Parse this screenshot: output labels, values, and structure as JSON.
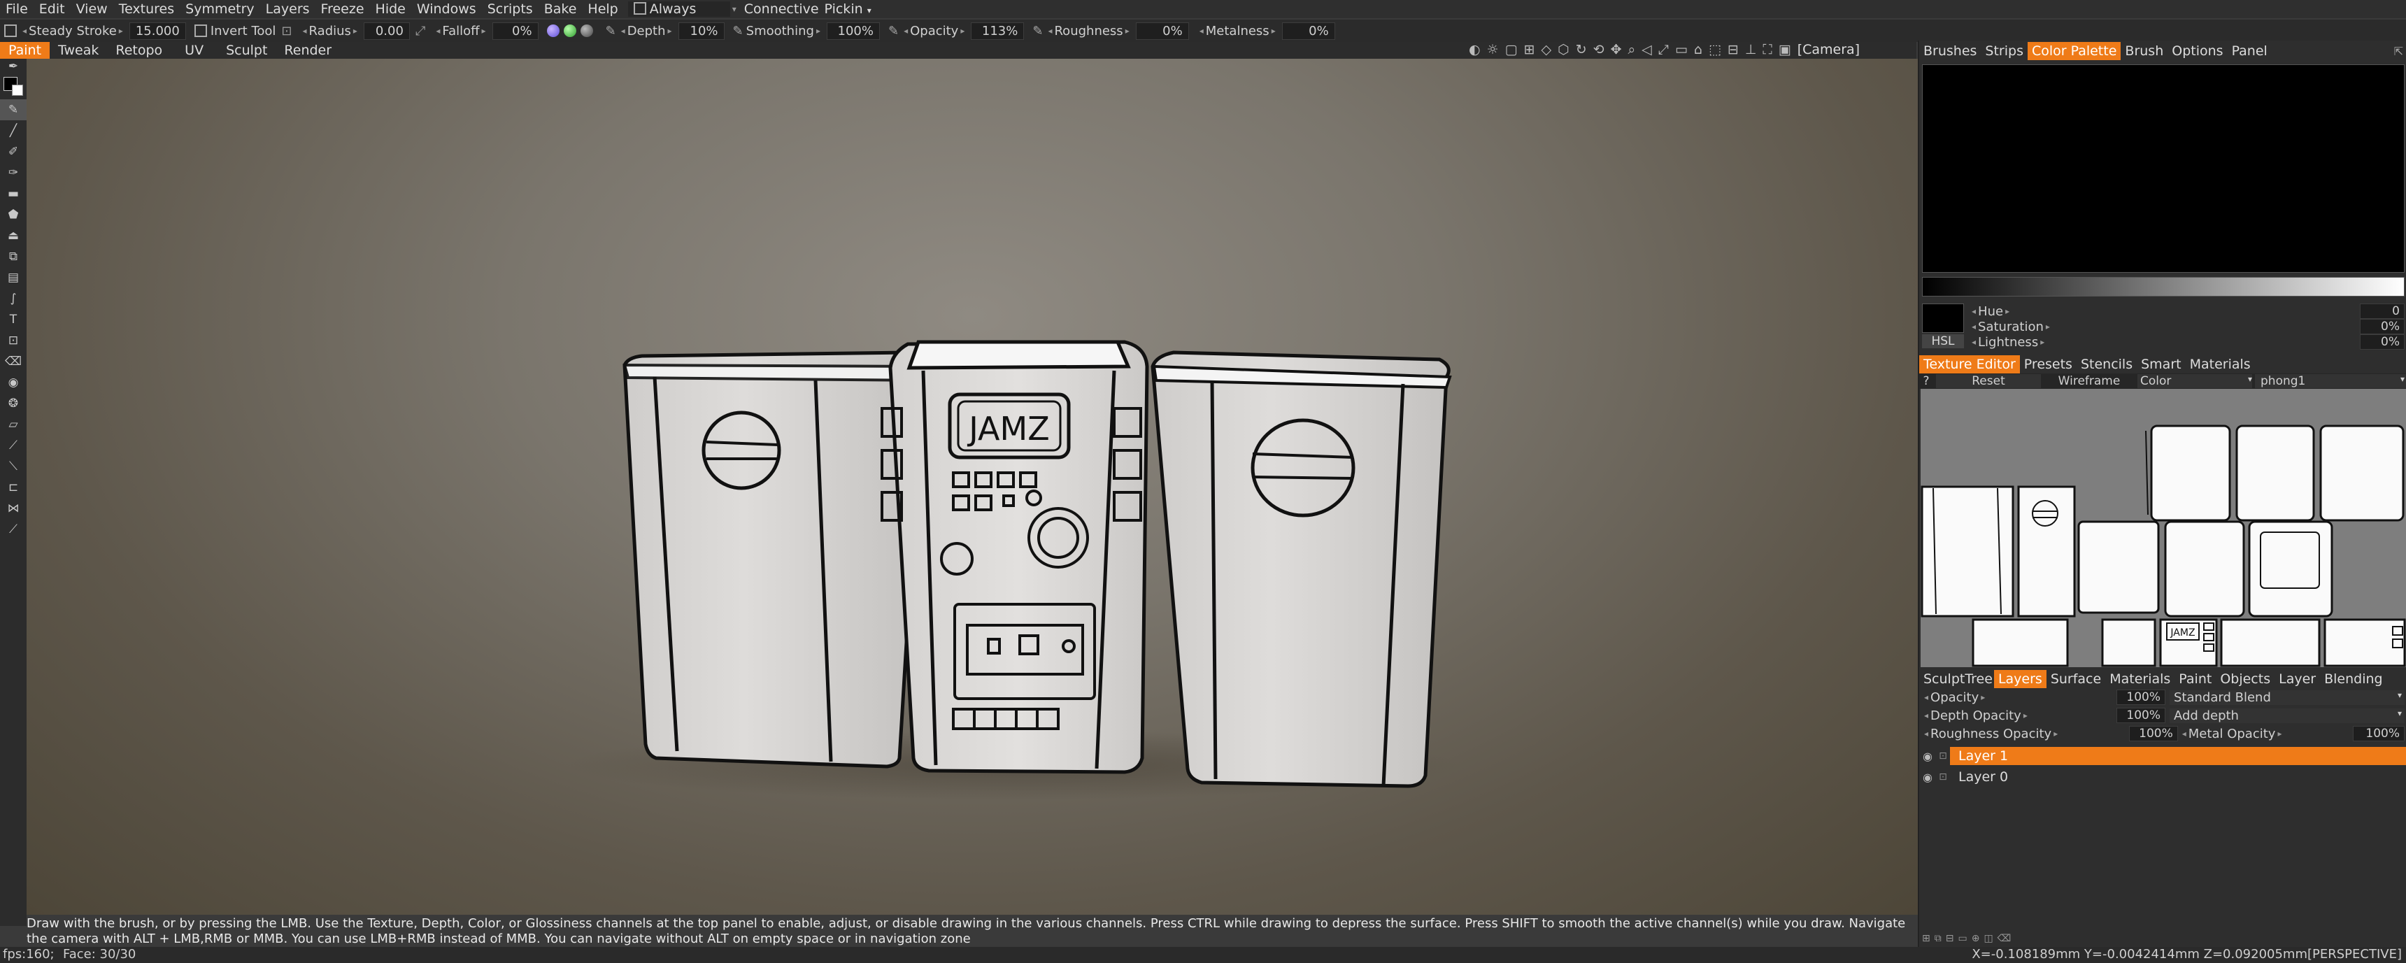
{
  "menu": {
    "items": [
      "File",
      "Edit",
      "View",
      "Textures",
      "Symmetry",
      "Layers",
      "Freeze",
      "Hide",
      "Windows",
      "Scripts",
      "Bake",
      "Help"
    ],
    "always_label": "Always",
    "connective_label": "Connective",
    "pickin_label": "Pickin"
  },
  "params": {
    "steady_stroke_label": "Steady",
    "stroke_label": "Stroke",
    "stroke_value": "15.000",
    "invert_tool_label": "Invert",
    "tool_label": "Tool",
    "radius_label": "Radius",
    "radius_value": "0.00",
    "falloff_label": "Falloff",
    "falloff_value": "0%",
    "depth_label": "Depth",
    "depth_value": "10%",
    "smoothing_label": "Smoothing",
    "smoothing_value": "100%",
    "opacity_label": "Opacity",
    "opacity_value": "113%",
    "roughness_label": "Roughness",
    "roughness_value": "0%",
    "metalness_label": "Metalness",
    "metalness_value": "0%"
  },
  "rooms": [
    "Paint",
    "Tweak",
    "Retopo",
    "UV",
    "Sculpt",
    "Render"
  ],
  "camera_label": "[Camera]",
  "model": {
    "label_text": "JAMZ"
  },
  "hint": {
    "line1": "Draw with the brush, or by pressing the LMB. Use the Texture, Depth, Color, or Glossiness channels at the top panel to enable, adjust, or disable drawing in the various channels. Press CTRL while drawing to depress the surface. Press SHIFT to smooth the active channel(s) while you draw. Navigate",
    "line2": "the camera with ALT + LMB,RMB or MMB. You can use LMB+RMB instead of MMB. You can navigate without ALT on empty space or in navigation zone"
  },
  "status": {
    "fps": "fps:160;",
    "face": "Face: 30/30",
    "coords": "X=-0.108189mm  Y=-0.0042414mm  Z=0.092005mm[PERSPECTIVE]"
  },
  "right_panel": {
    "top_tabs": [
      "Brushes",
      "Strips",
      "Color",
      "Palette",
      "Brush",
      "Options",
      "Panel"
    ],
    "hsl": {
      "mode": "HSL",
      "hue_label": "Hue",
      "hue_value": "0",
      "saturation_label": "Saturation",
      "saturation_value": "0%",
      "lightness_label": "Lightness",
      "lightness_value": "0%"
    },
    "texture_tabs": [
      "Texture",
      "Editor",
      "Presets",
      "Stencils",
      "Smart",
      "Materials"
    ],
    "texture_editor": {
      "help": "?",
      "reset": "Reset",
      "wireframe": "Wireframe",
      "channel": "Color",
      "material": "phong1"
    },
    "layer_tabs": [
      "SculptTree",
      "Layers",
      "Surface",
      "Materials",
      "Paint",
      "Objects",
      "Layer",
      "Blending"
    ],
    "layers_props": {
      "opacity_label": "Opacity",
      "opacity_value": "100%",
      "blend_mode": "Standard Blend",
      "depth_opacity_label": "Depth Opacity",
      "depth_opacity_value": "100%",
      "depth_mode": "Add depth",
      "roughness_opacity_label": "Roughness Opacity",
      "roughness_opacity_value": "100%",
      "metal_opacity_label": "Metal Opacity",
      "metal_opacity_value": "100%"
    },
    "layers": [
      {
        "name": "Layer 1",
        "active": true
      },
      {
        "name": "Layer 0",
        "active": false
      }
    ]
  },
  "colors": {
    "accent": "#ef7b18",
    "panel_bg": "#2e2e2e",
    "primary_color": "#000000"
  }
}
